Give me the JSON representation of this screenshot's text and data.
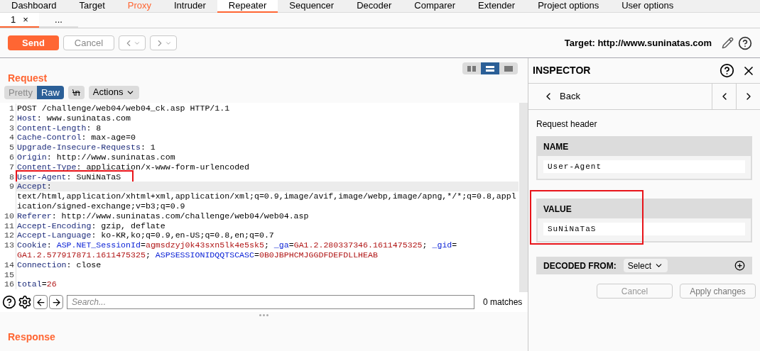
{
  "main_tabs": [
    {
      "label": "Dashboard",
      "selected": false,
      "highlighted": false
    },
    {
      "label": "Target",
      "selected": false,
      "highlighted": false
    },
    {
      "label": "Proxy",
      "selected": false,
      "highlighted": true
    },
    {
      "label": "Intruder",
      "selected": false,
      "highlighted": false
    },
    {
      "label": "Repeater",
      "selected": true,
      "highlighted": false
    },
    {
      "label": "Sequencer",
      "selected": false,
      "highlighted": false
    },
    {
      "label": "Decoder",
      "selected": false,
      "highlighted": false
    },
    {
      "label": "Comparer",
      "selected": false,
      "highlighted": false
    },
    {
      "label": "Extender",
      "selected": false,
      "highlighted": false
    },
    {
      "label": "Project options",
      "selected": false,
      "highlighted": false
    },
    {
      "label": "User options",
      "selected": false,
      "highlighted": false
    }
  ],
  "sub_tabs": [
    {
      "label": "1",
      "close": "×",
      "selected": true
    },
    {
      "label": "...",
      "selected": false
    }
  ],
  "toolbar": {
    "send": "Send",
    "cancel": "Cancel",
    "target": "Target: http://www.suninatas.com"
  },
  "request": {
    "title": "Request",
    "view_modes": [
      {
        "selected": false
      },
      {
        "selected": true
      },
      {
        "selected": false
      }
    ],
    "formats": [
      {
        "label": "Pretty",
        "selected": false
      },
      {
        "label": "Raw",
        "selected": true
      }
    ],
    "newline_toggle": "\\n",
    "actions": "Actions",
    "lines": [
      {
        "number": "1",
        "current": false,
        "boxed": false,
        "segments": [
          {
            "kind": "text",
            "text": "POST /challenge/web04/web04_ck.asp HTTP/1.1"
          }
        ]
      },
      {
        "number": "2",
        "current": false,
        "boxed": false,
        "segments": [
          {
            "kind": "key",
            "text": "Host"
          },
          {
            "kind": "text",
            "text": ": www.suninatas.com"
          }
        ]
      },
      {
        "number": "3",
        "current": false,
        "boxed": false,
        "segments": [
          {
            "kind": "key",
            "text": "Content-Length"
          },
          {
            "kind": "text",
            "text": ": 8"
          }
        ]
      },
      {
        "number": "4",
        "current": false,
        "boxed": false,
        "segments": [
          {
            "kind": "key",
            "text": "Cache-Control"
          },
          {
            "kind": "text",
            "text": ": max-age=0"
          }
        ]
      },
      {
        "number": "5",
        "current": false,
        "boxed": false,
        "segments": [
          {
            "kind": "key",
            "text": "Upgrade-Insecure-Requests"
          },
          {
            "kind": "text",
            "text": ": 1"
          }
        ]
      },
      {
        "number": "6",
        "current": false,
        "boxed": false,
        "segments": [
          {
            "kind": "key",
            "text": "Origin"
          },
          {
            "kind": "text",
            "text": ": http://www.suninatas.com"
          }
        ]
      },
      {
        "number": "7",
        "current": false,
        "boxed": false,
        "segments": [
          {
            "kind": "key",
            "text": "Content-Type"
          },
          {
            "kind": "text",
            "text": ": application/x-www-form-urlencoded"
          }
        ]
      },
      {
        "number": "8",
        "current": false,
        "boxed": true,
        "segments": [
          {
            "kind": "key",
            "text": "User-Agent"
          },
          {
            "kind": "text",
            "text": ": SuNiNaTaS"
          }
        ]
      },
      {
        "number": "9",
        "current": true,
        "boxed": false,
        "segments": [
          {
            "kind": "key",
            "text": "Accept"
          },
          {
            "kind": "text",
            "text": ": text/html,application/xhtml+xml,application/xml;q=0.9,image/avif,image/webp,image/apng,*/*;q=0.8,application/signed-exchange;v=b3;q=0.9"
          }
        ]
      },
      {
        "number": "10",
        "current": false,
        "boxed": false,
        "segments": [
          {
            "kind": "key",
            "text": "Referer"
          },
          {
            "kind": "text",
            "text": ": http://www.suninatas.com/challenge/web04/web04.asp"
          }
        ]
      },
      {
        "number": "11",
        "current": false,
        "boxed": false,
        "segments": [
          {
            "kind": "key",
            "text": "Accept-Encoding"
          },
          {
            "kind": "text",
            "text": ": gzip, deflate"
          }
        ]
      },
      {
        "number": "12",
        "current": false,
        "boxed": false,
        "segments": [
          {
            "kind": "key",
            "text": "Accept-Language"
          },
          {
            "kind": "text",
            "text": ": ko-KR,ko;q=0.9,en-US;q=0.8,en;q=0.7"
          }
        ]
      },
      {
        "number": "13",
        "current": false,
        "boxed": false,
        "segments": [
          {
            "kind": "key",
            "text": "Cookie"
          },
          {
            "kind": "text",
            "text": ": "
          },
          {
            "kind": "param",
            "text": "ASP.NET_SessionId"
          },
          {
            "kind": "text",
            "text": "="
          },
          {
            "kind": "value",
            "text": "agmsdzyj0k43sxn5lk4e5sk5"
          },
          {
            "kind": "text",
            "text": "; "
          },
          {
            "kind": "param",
            "text": "_ga"
          },
          {
            "kind": "text",
            "text": "="
          },
          {
            "kind": "value",
            "text": "GA1.2.280337346.1611475325"
          },
          {
            "kind": "text",
            "text": "; "
          },
          {
            "kind": "param",
            "text": "_gid"
          },
          {
            "kind": "text",
            "text": "="
          },
          {
            "kind": "value",
            "text": "GA1.2.577917871.1611475325"
          },
          {
            "kind": "text",
            "text": "; "
          },
          {
            "kind": "param",
            "text": "ASPSESSIONIDQQTSCASC"
          },
          {
            "kind": "text",
            "text": "="
          },
          {
            "kind": "value",
            "text": "0B0JBPHCMJGGDFDEFDLLHEAB"
          }
        ]
      },
      {
        "number": "14",
        "current": false,
        "boxed": false,
        "segments": [
          {
            "kind": "key",
            "text": "Connection"
          },
          {
            "kind": "text",
            "text": ": close"
          }
        ]
      },
      {
        "number": "15",
        "current": false,
        "boxed": false
      },
      {
        "number": "16",
        "current": false,
        "boxed": false,
        "segments": [
          {
            "kind": "key",
            "text": "total"
          },
          {
            "kind": "text",
            "text": "="
          },
          {
            "kind": "value",
            "text": "26"
          }
        ]
      }
    ],
    "search": {
      "placeholder": "Search...",
      "matches": "0 matches"
    }
  },
  "response": {
    "title": "Response"
  },
  "inspector": {
    "title": "INSPECTOR",
    "back": "Back",
    "section": "Request header",
    "name": {
      "label": "NAME",
      "value": "User-Agent",
      "boxed": false
    },
    "value": {
      "label": "VALUE",
      "value": "SuNiNaTaS",
      "boxed": true
    },
    "decoded_from": {
      "label": "DECODED FROM:",
      "select": "Select"
    },
    "cancel": "Cancel",
    "apply": "Apply changes"
  }
}
